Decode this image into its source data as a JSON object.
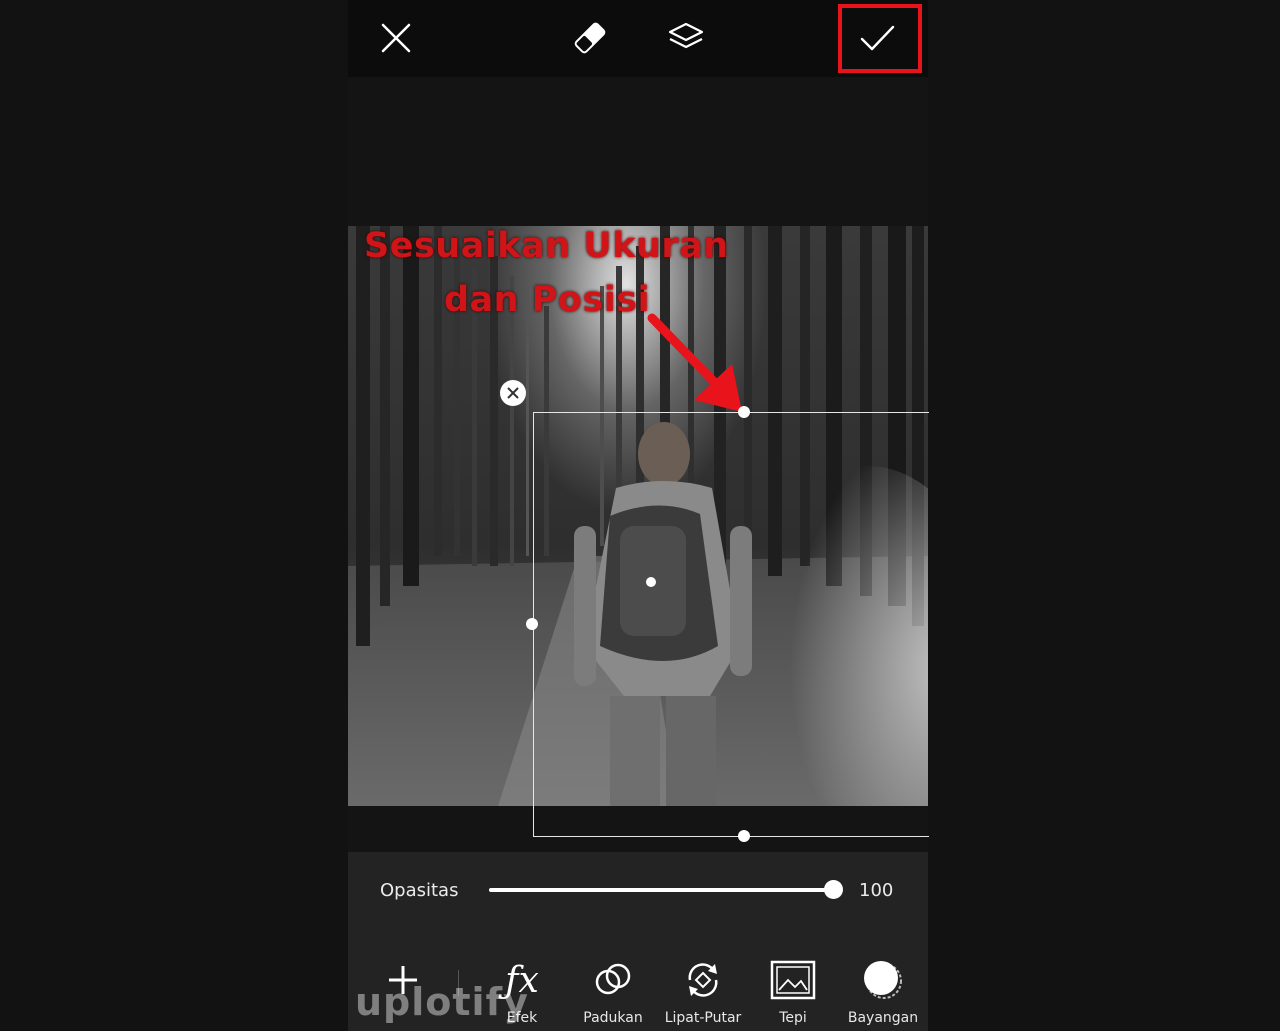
{
  "toolbar": {
    "close_icon": "close-icon",
    "eraser_icon": "eraser-icon",
    "layers_icon": "layers-icon",
    "apply_icon": "check-icon",
    "highlight_color": "#e8131b"
  },
  "canvas": {
    "annotation_line1": "Sesuaikan Ukuran",
    "annotation_line2": "dan Posisi",
    "annotation_color": "#d01418"
  },
  "opacity": {
    "label": "Opasitas",
    "value": "100"
  },
  "tools": [
    {
      "label": "",
      "icon": "plus-icon"
    },
    {
      "label": "Efek",
      "icon": "fx-icon"
    },
    {
      "label": "Padukan",
      "icon": "blend-icon"
    },
    {
      "label": "Lipat-Putar",
      "icon": "flip-rotate-icon"
    },
    {
      "label": "Tepi",
      "icon": "border-image-icon"
    },
    {
      "label": "Bayangan",
      "icon": "shadow-icon"
    }
  ],
  "watermark": "uplotify"
}
